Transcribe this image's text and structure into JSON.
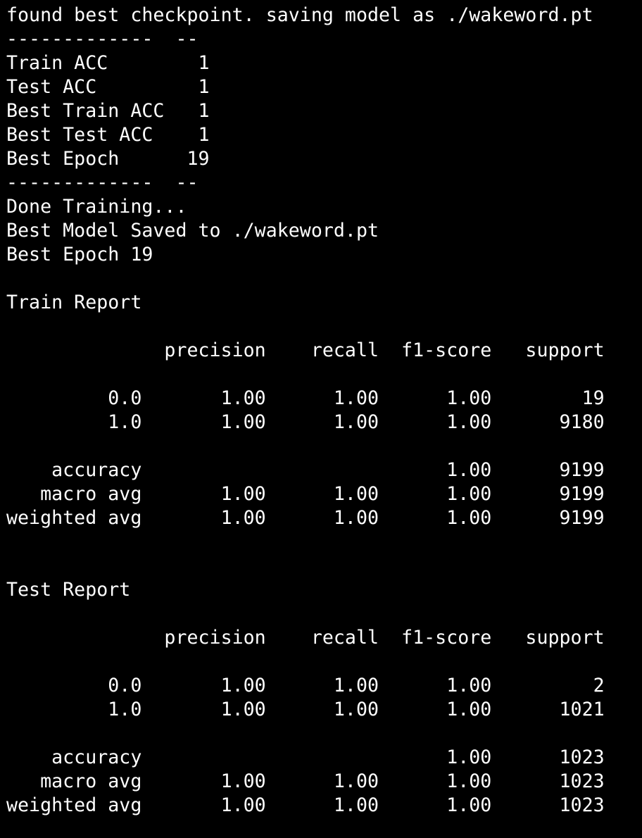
{
  "terminal": {
    "background": "#000000",
    "foreground": "#ffffff",
    "lines": [
      "found best checkpoint. saving model as ./wakeword.pt",
      "-------------  --",
      "Train ACC        1",
      "Test ACC         1",
      "Best Train ACC   1",
      "Best Test ACC    1",
      "Best Epoch      19",
      "-------------  --",
      "Done Training...",
      "Best Model Saved to ./wakeword.pt",
      "Best Epoch 19",
      "",
      "Train Report",
      "",
      "              precision    recall  f1-score   support",
      "",
      "         0.0       1.00      1.00      1.00        19",
      "         1.0       1.00      1.00      1.00      9180",
      "",
      "    accuracy                           1.00      9199",
      "   macro avg       1.00      1.00      1.00      9199",
      "weighted avg       1.00      1.00      1.00      9199",
      "",
      "",
      "Test Report",
      "",
      "              precision    recall  f1-score   support",
      "",
      "         0.0       1.00      1.00      1.00         2",
      "         1.0       1.00      1.00      1.00      1021",
      "",
      "    accuracy                           1.00      1023",
      "   macro avg       1.00      1.00      1.00      1023",
      "weighted avg       1.00      1.00      1.00      1023"
    ]
  }
}
